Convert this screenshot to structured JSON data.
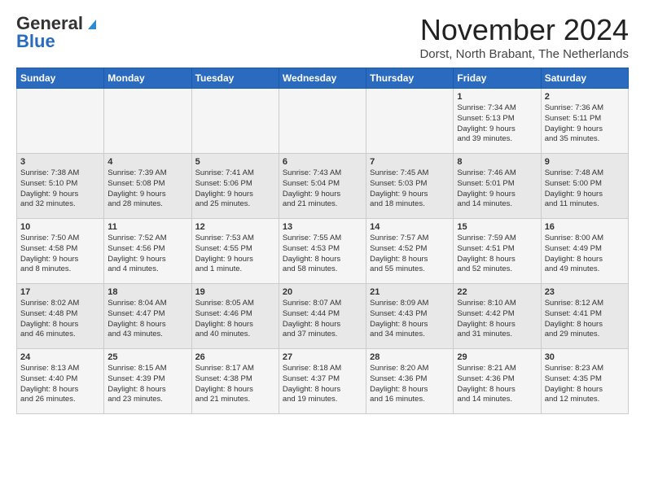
{
  "logo": {
    "general": "General",
    "blue": "Blue"
  },
  "title": "November 2024",
  "location": "Dorst, North Brabant, The Netherlands",
  "weekdays": [
    "Sunday",
    "Monday",
    "Tuesday",
    "Wednesday",
    "Thursday",
    "Friday",
    "Saturday"
  ],
  "weeks": [
    [
      {
        "day": "",
        "info": ""
      },
      {
        "day": "",
        "info": ""
      },
      {
        "day": "",
        "info": ""
      },
      {
        "day": "",
        "info": ""
      },
      {
        "day": "",
        "info": ""
      },
      {
        "day": "1",
        "info": "Sunrise: 7:34 AM\nSunset: 5:13 PM\nDaylight: 9 hours\nand 39 minutes."
      },
      {
        "day": "2",
        "info": "Sunrise: 7:36 AM\nSunset: 5:11 PM\nDaylight: 9 hours\nand 35 minutes."
      }
    ],
    [
      {
        "day": "3",
        "info": "Sunrise: 7:38 AM\nSunset: 5:10 PM\nDaylight: 9 hours\nand 32 minutes."
      },
      {
        "day": "4",
        "info": "Sunrise: 7:39 AM\nSunset: 5:08 PM\nDaylight: 9 hours\nand 28 minutes."
      },
      {
        "day": "5",
        "info": "Sunrise: 7:41 AM\nSunset: 5:06 PM\nDaylight: 9 hours\nand 25 minutes."
      },
      {
        "day": "6",
        "info": "Sunrise: 7:43 AM\nSunset: 5:04 PM\nDaylight: 9 hours\nand 21 minutes."
      },
      {
        "day": "7",
        "info": "Sunrise: 7:45 AM\nSunset: 5:03 PM\nDaylight: 9 hours\nand 18 minutes."
      },
      {
        "day": "8",
        "info": "Sunrise: 7:46 AM\nSunset: 5:01 PM\nDaylight: 9 hours\nand 14 minutes."
      },
      {
        "day": "9",
        "info": "Sunrise: 7:48 AM\nSunset: 5:00 PM\nDaylight: 9 hours\nand 11 minutes."
      }
    ],
    [
      {
        "day": "10",
        "info": "Sunrise: 7:50 AM\nSunset: 4:58 PM\nDaylight: 9 hours\nand 8 minutes."
      },
      {
        "day": "11",
        "info": "Sunrise: 7:52 AM\nSunset: 4:56 PM\nDaylight: 9 hours\nand 4 minutes."
      },
      {
        "day": "12",
        "info": "Sunrise: 7:53 AM\nSunset: 4:55 PM\nDaylight: 9 hours\nand 1 minute."
      },
      {
        "day": "13",
        "info": "Sunrise: 7:55 AM\nSunset: 4:53 PM\nDaylight: 8 hours\nand 58 minutes."
      },
      {
        "day": "14",
        "info": "Sunrise: 7:57 AM\nSunset: 4:52 PM\nDaylight: 8 hours\nand 55 minutes."
      },
      {
        "day": "15",
        "info": "Sunrise: 7:59 AM\nSunset: 4:51 PM\nDaylight: 8 hours\nand 52 minutes."
      },
      {
        "day": "16",
        "info": "Sunrise: 8:00 AM\nSunset: 4:49 PM\nDaylight: 8 hours\nand 49 minutes."
      }
    ],
    [
      {
        "day": "17",
        "info": "Sunrise: 8:02 AM\nSunset: 4:48 PM\nDaylight: 8 hours\nand 46 minutes."
      },
      {
        "day": "18",
        "info": "Sunrise: 8:04 AM\nSunset: 4:47 PM\nDaylight: 8 hours\nand 43 minutes."
      },
      {
        "day": "19",
        "info": "Sunrise: 8:05 AM\nSunset: 4:46 PM\nDaylight: 8 hours\nand 40 minutes."
      },
      {
        "day": "20",
        "info": "Sunrise: 8:07 AM\nSunset: 4:44 PM\nDaylight: 8 hours\nand 37 minutes."
      },
      {
        "day": "21",
        "info": "Sunrise: 8:09 AM\nSunset: 4:43 PM\nDaylight: 8 hours\nand 34 minutes."
      },
      {
        "day": "22",
        "info": "Sunrise: 8:10 AM\nSunset: 4:42 PM\nDaylight: 8 hours\nand 31 minutes."
      },
      {
        "day": "23",
        "info": "Sunrise: 8:12 AM\nSunset: 4:41 PM\nDaylight: 8 hours\nand 29 minutes."
      }
    ],
    [
      {
        "day": "24",
        "info": "Sunrise: 8:13 AM\nSunset: 4:40 PM\nDaylight: 8 hours\nand 26 minutes."
      },
      {
        "day": "25",
        "info": "Sunrise: 8:15 AM\nSunset: 4:39 PM\nDaylight: 8 hours\nand 23 minutes."
      },
      {
        "day": "26",
        "info": "Sunrise: 8:17 AM\nSunset: 4:38 PM\nDaylight: 8 hours\nand 21 minutes."
      },
      {
        "day": "27",
        "info": "Sunrise: 8:18 AM\nSunset: 4:37 PM\nDaylight: 8 hours\nand 19 minutes."
      },
      {
        "day": "28",
        "info": "Sunrise: 8:20 AM\nSunset: 4:36 PM\nDaylight: 8 hours\nand 16 minutes."
      },
      {
        "day": "29",
        "info": "Sunrise: 8:21 AM\nSunset: 4:36 PM\nDaylight: 8 hours\nand 14 minutes."
      },
      {
        "day": "30",
        "info": "Sunrise: 8:23 AM\nSunset: 4:35 PM\nDaylight: 8 hours\nand 12 minutes."
      }
    ]
  ]
}
